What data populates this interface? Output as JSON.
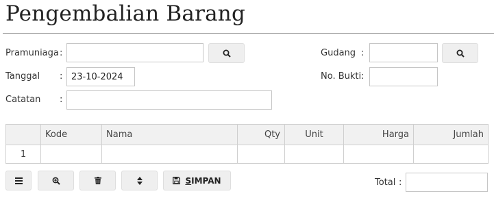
{
  "page": {
    "title": "Pengembalian Barang"
  },
  "form": {
    "pramuniaga": {
      "label": "Pramuniaga",
      "colon": ":",
      "value": ""
    },
    "tanggal": {
      "label": "Tanggal",
      "colon": ":",
      "value": "23-10-2024"
    },
    "catatan": {
      "label": "Catatan",
      "colon": ":",
      "value": ""
    },
    "gudang": {
      "label": "Gudang",
      "colon": ":",
      "value": ""
    },
    "no_bukti": {
      "label": "No. Bukti",
      "colon": ":",
      "value": ""
    }
  },
  "table": {
    "headers": [
      "",
      "Kode",
      "Nama",
      "Qty",
      "Unit",
      "Harga",
      "Jumlah"
    ],
    "rows": [
      [
        "1",
        "",
        "",
        "",
        "",
        "",
        ""
      ]
    ]
  },
  "toolbar": {
    "menu_icon": "bars-icon",
    "zoom_icon": "zoom-in-icon",
    "delete_icon": "trash-icon",
    "sort_icon": "sort-icon",
    "save_icon": "floppy-disk-icon",
    "save_label_first": "S",
    "save_label_rest": "IMPAN"
  },
  "total": {
    "label": "Total",
    "colon": ":",
    "value": ""
  }
}
